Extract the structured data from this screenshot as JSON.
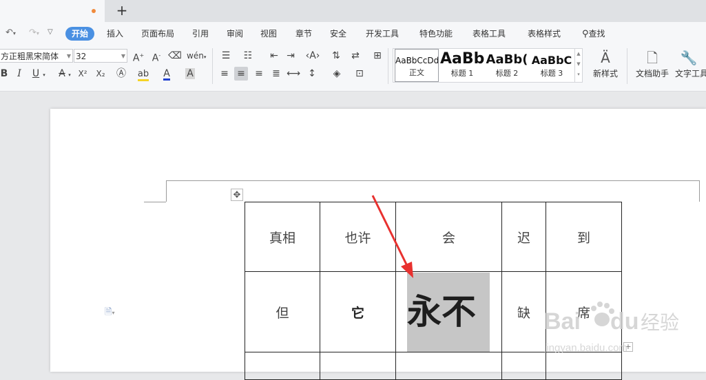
{
  "quick_access": {
    "undo_icon": "undo-icon",
    "redo_icon": "redo-icon",
    "customize_icon": "customize-icon"
  },
  "menu": {
    "items": [
      "开始",
      "插入",
      "页面布局",
      "引用",
      "审阅",
      "视图",
      "章节",
      "安全",
      "开发工具",
      "特色功能",
      "表格工具",
      "表格样式"
    ],
    "active": "开始",
    "search_label": "查找"
  },
  "font": {
    "family": "方正粗黑宋简体",
    "size": "32"
  },
  "styles": [
    {
      "sample": "AaBbCcDd",
      "name": "正文",
      "active": true
    },
    {
      "sample": "AaBb",
      "name": "标题 1"
    },
    {
      "sample": "AaBb(",
      "name": "标题 2"
    },
    {
      "sample": "AaBbC",
      "name": "标题 3"
    }
  ],
  "ribbon_buttons": {
    "new_style": "新样式",
    "doc_assistant": "文档助手",
    "text_tools": "文字工具"
  },
  "table": {
    "rows": [
      [
        "真相",
        "也许",
        "会",
        "迟",
        "到"
      ],
      [
        "但",
        "它",
        "永不",
        "缺",
        "席"
      ],
      [
        "",
        "",
        "",
        "",
        ""
      ]
    ]
  },
  "colors": {
    "accent": "#4a90e2",
    "highlight": "#f5d327",
    "font_color": "#1f3fd0",
    "selection": "#c6c6c6",
    "arrow": "#e8312f",
    "tab_dot": "#f08a3c"
  },
  "watermark": {
    "brand": "Baidu经验",
    "url": "jingyan.baidu.com"
  }
}
